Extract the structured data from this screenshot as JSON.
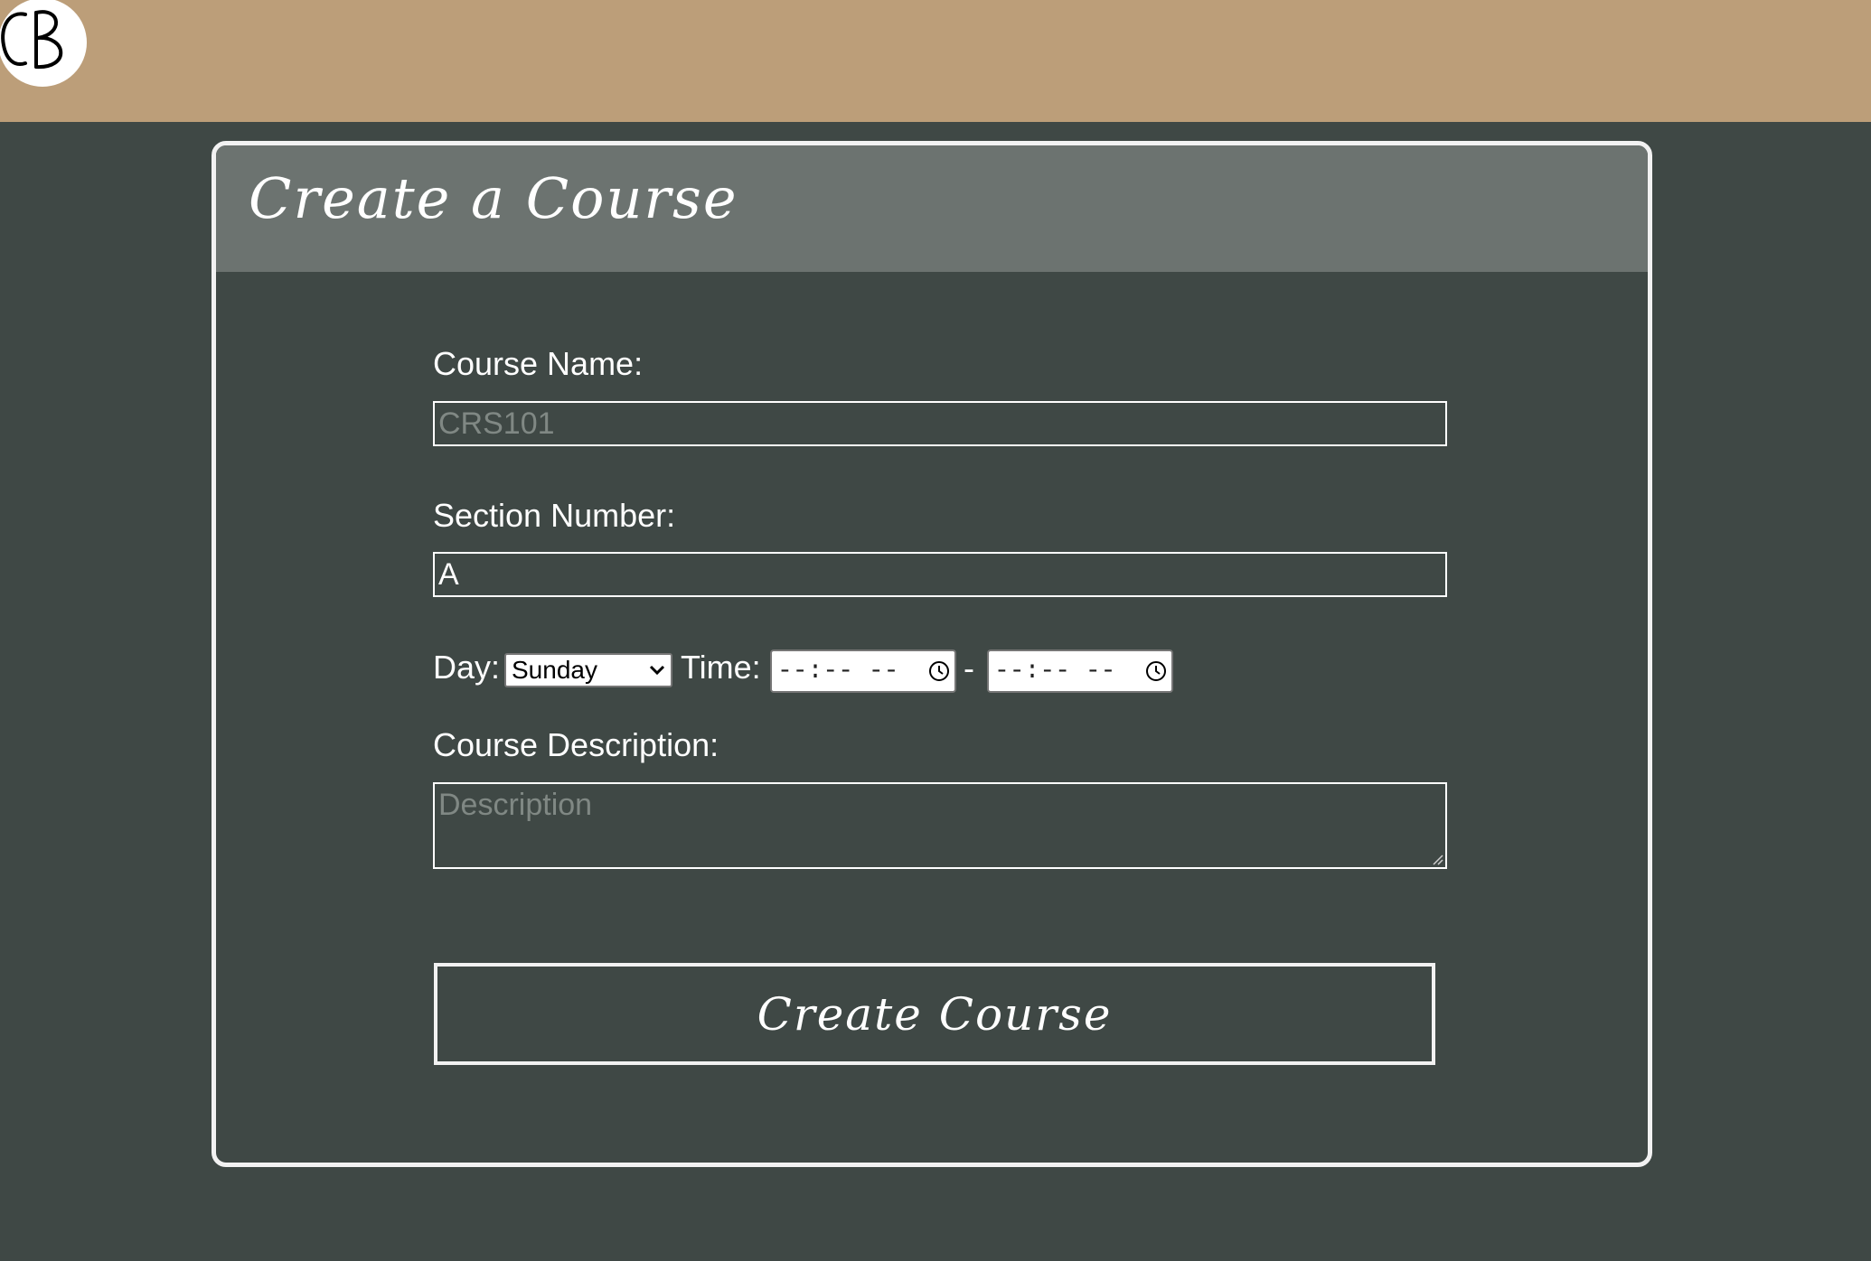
{
  "header": {
    "logo_text": "CB",
    "background_color": "#bc9e79"
  },
  "card": {
    "title": "Create a Course",
    "header_color": "#6c7370",
    "body_color": "#3f4845"
  },
  "form": {
    "course_name": {
      "label": "Course Name:",
      "placeholder": "CRS101",
      "value": ""
    },
    "section_number": {
      "label": "Section Number:",
      "value": "A"
    },
    "day": {
      "label": "Day:",
      "selected": "Sunday"
    },
    "time": {
      "label": "Time:",
      "start": "--:-- --",
      "separator": "-",
      "end": "--:-- --",
      "icon": "clock-icon"
    },
    "description": {
      "label": "Course Description:",
      "placeholder": "Description",
      "value": ""
    },
    "submit_label": "Create Course"
  }
}
